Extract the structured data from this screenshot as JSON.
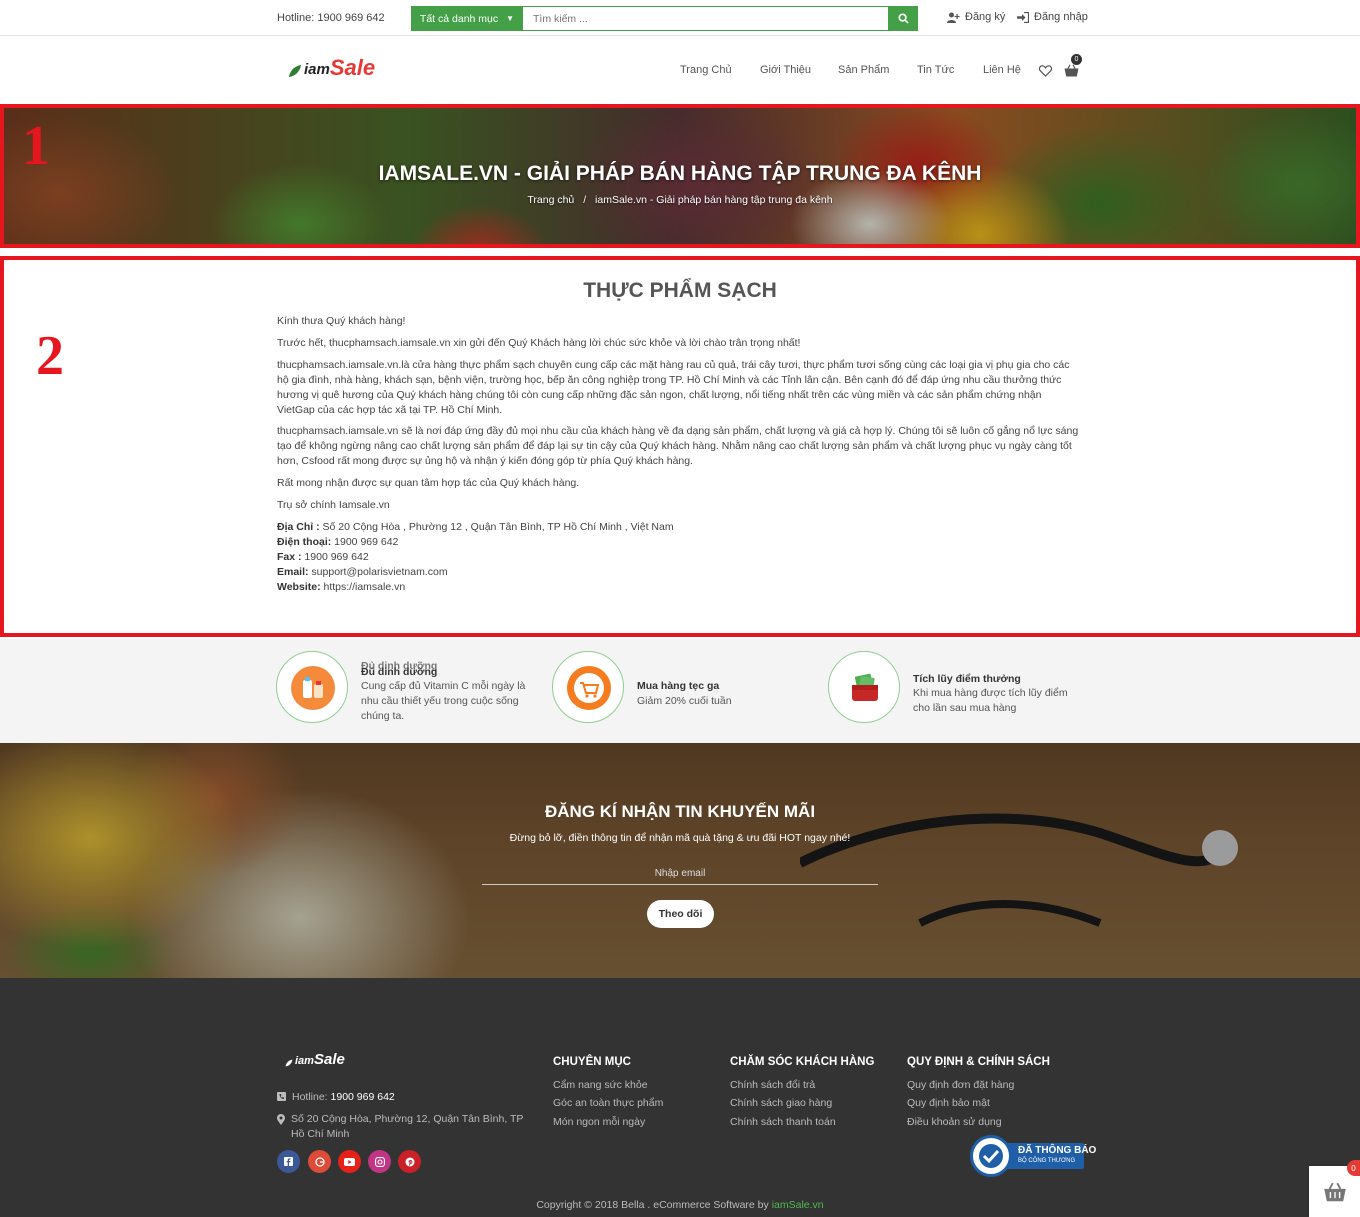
{
  "topbar": {
    "hotline": "Hotline: 1900 969 642",
    "category_label": "Tất cả danh mục",
    "search_placeholder": "Tìm kiếm ...",
    "register": "Đăng ký",
    "login": "Đăng nhập"
  },
  "header": {
    "logo_prefix": "iam",
    "logo_main": "Sale",
    "nav": [
      "Trang Chủ",
      "Giới Thiệu",
      "Sản Phẩm",
      "Tin Tức",
      "Liên Hệ"
    ],
    "cart_count": "0"
  },
  "banner": {
    "title": "IAMSALE.VN - GIẢI PHÁP BÁN HÀNG TẬP TRUNG ĐA KÊNH",
    "breadcrumb_home": "Trang chủ",
    "breadcrumb_sep": "/",
    "breadcrumb_current": "iamSale.vn - Giải pháp bán hàng tập trung đa kênh"
  },
  "annotations": {
    "box1": "1",
    "box2": "2",
    "color": "#e5161e"
  },
  "content": {
    "title": "THỰC PHẨM SẠCH",
    "p1": "Kính thưa Quý khách hàng!",
    "p2": "Trước hết, thucphamsach.iamsale.vn xin gửi đến Quý Khách hàng lời chúc sức khỏe và lời chào trân trọng nhất!",
    "p3": "thucphamsach.iamsale.vn.là cửa hàng thực phẩm sạch  chuyên cung cấp các mặt hàng rau củ quả, trái cây tươi, thực phẩm tươi sống cùng các loại gia vị phụ gia cho các hộ gia đình, nhà hàng, khách sạn, bệnh viện, trường học, bếp ăn công nghiệp trong TP. Hồ Chí Minh và các Tỉnh lân cận. Bên cạnh đó để đáp ứng nhu cầu thưởng thức hương vị quê hương của Quý khách hàng chúng tôi còn cung cấp những đặc sản ngon, chất lượng, nổi tiếng nhất trên các vùng miền và các sản phẩm chứng nhận VietGap của các hợp tác xã tại TP. Hồ Chí Minh.",
    "p4": "thucphamsach.iamsale.vn sẽ là nơi đáp ứng đầy đủ mọi nhu cầu của khách hàng về đa dạng sản phẩm, chất lượng và giá cả hợp lý. Chúng tôi sẽ luôn cố gắng nổ lực sáng tạo để không ngừng nâng cao chất lượng sản phẩm để đáp lại sự tin cậy của Quý khách hàng. Nhằm nâng cao chất lượng sản phẩm và chất lượng phục vụ ngày càng tốt hơn, Csfood rất mong được sự ủng hộ và nhận ý kiến đóng góp từ phía Quý khách hàng.",
    "p5": "Rất mong nhận được sự quan tâm hợp tác của Quý khách hàng.",
    "p6": "Trụ sở chính Iamsale.vn",
    "address_label": "Địa Chỉ :",
    "address": " Số 20 Cộng Hòa , Phường 12 , Quận Tân Bình, TP Hồ Chí Minh , Việt Nam",
    "phone_label": "Điện thoại:",
    "phone": " 1900 969 642",
    "fax_label": "Fax :",
    "fax": " 1900 969 642",
    "email_label": "Email:",
    "email": " support@polarisvietnam.com",
    "website_label": "Website:",
    "website": " https://iamsale.vn"
  },
  "features": [
    {
      "ghost": "Đủ dinh dưỡng",
      "title": "Đủ dinh dưỡng",
      "desc": "Cung cấp đủ Vitamin C mỗi ngày là nhu cầu thiết yếu trong cuộc sống chúng ta.",
      "icon": "bottles-icon",
      "color": "#f58a3b"
    },
    {
      "title": "Mua hàng tẹc ga",
      "desc": "Giảm 20% cuối tuần",
      "icon": "shopping-cart-icon",
      "color": "#f57c1f"
    },
    {
      "title": "Tích lũy điểm thưởng",
      "desc": "Khi mua hàng được tích lũy điểm cho lần sau mua hàng",
      "icon": "wallet-icon",
      "color": "#c62828"
    }
  ],
  "newsletter": {
    "title": "ĐĂNG KÍ NHẬN TIN KHUYẾN MÃI",
    "subtitle": "Đừng bỏ lỡ, điền thông tin để nhận mã quà tặng & ưu đãi HOT ngay nhé!",
    "placeholder": "Nhập email",
    "button": "Theo dõi"
  },
  "footer": {
    "logo_prefix": "iam",
    "logo_main": "Sale",
    "hotline_label": "Hotline: ",
    "hotline": "1900 969 642",
    "address": "Số 20 Cộng Hòa, Phường 12, Quận Tân Bình, TP Hồ Chí Minh",
    "col1_title": "CHUYÊN MỤC",
    "col1_links": [
      "Cẩm nang sức khỏe",
      "Góc an toàn thực phẩm",
      "Món ngon mỗi ngày"
    ],
    "col2_title": "CHĂM SÓC KHÁCH HÀNG",
    "col2_links": [
      "Chính sách đổi trả",
      "Chính sách giao hàng",
      "Chính sách thanh toán"
    ],
    "col3_title": "QUY ĐỊNH & CHÍNH SÁCH",
    "col3_links": [
      "Quy định đơn đặt hàng",
      "Quy định bảo mật",
      "Điều khoản sử dụng"
    ],
    "badge_line1": "ĐÃ THÔNG BÁO",
    "badge_line2": "BỘ CÔNG THƯƠNG",
    "copyright_prefix": "Copyright © 2018 Bella . eCommerce Software by ",
    "copyright_brand": "iamSale.vn",
    "float_cart_count": "0"
  },
  "colors": {
    "accent": "#43a047",
    "brand_red": "#e53935",
    "footer_bg": "#333333"
  }
}
